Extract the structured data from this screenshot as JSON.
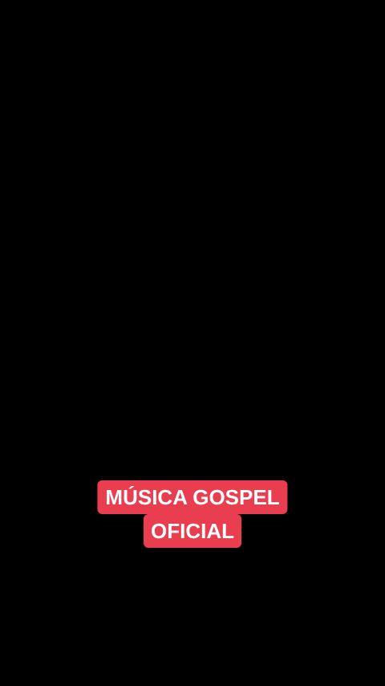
{
  "caption": {
    "line1": "MÚSICA GOSPEL",
    "line2": "OFICIAL"
  },
  "colors": {
    "background": "#000000",
    "caption_bg": "#e93e4f",
    "caption_text": "#ffffff"
  }
}
